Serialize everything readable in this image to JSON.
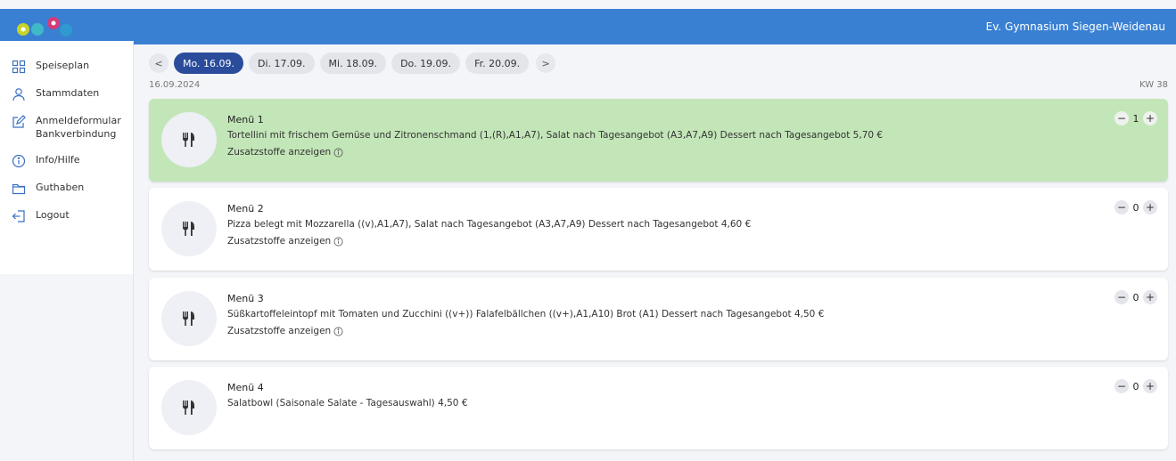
{
  "header": {
    "school_name": "Ev. Gymnasium Siegen-Weidenau"
  },
  "sidebar": {
    "items": [
      {
        "label": "Speiseplan",
        "icon": "grid-icon"
      },
      {
        "label": "Stammdaten",
        "icon": "user-icon"
      },
      {
        "label": "Anmeldeformular Bankverbindung",
        "icon": "edit-icon"
      },
      {
        "label": "Info/Hilfe",
        "icon": "info-icon"
      },
      {
        "label": "Guthaben",
        "icon": "folder-icon"
      },
      {
        "label": "Logout",
        "icon": "logout-icon"
      }
    ]
  },
  "days": {
    "prev": "<",
    "next": ">",
    "items": [
      {
        "label": "Mo. 16.09.",
        "active": true
      },
      {
        "label": "Di. 17.09.",
        "active": false
      },
      {
        "label": "Mi. 18.09.",
        "active": false
      },
      {
        "label": "Do. 19.09.",
        "active": false
      },
      {
        "label": "Fr. 20.09.",
        "active": false
      }
    ]
  },
  "date": "16.09.2024",
  "week": "KW 38",
  "additives_label": "Zusatzstoffe anzeigen",
  "menus": [
    {
      "title": "Menü 1",
      "description": "Tortellini mit frischem Gemüse und Zitronenschmand (1,(R),A1,A7), Salat nach Tagesangebot (A3,A7,A9) Dessert nach Tagesangebot 5,70 €",
      "qty": "1",
      "selected": true,
      "has_additives": true
    },
    {
      "title": "Menü 2",
      "description": "Pizza belegt mit Mozzarella ((v),A1,A7), Salat nach Tagesangebot (A3,A7,A9) Dessert nach Tagesangebot 4,60 €",
      "qty": "0",
      "selected": false,
      "has_additives": true
    },
    {
      "title": "Menü 3",
      "description": "Süßkartoffeleintopf mit Tomaten und Zucchini ((v+)) Falafelbällchen ((v+),A1,A10) Brot (A1) Dessert nach Tagesangebot 4,50 €",
      "qty": "0",
      "selected": false,
      "has_additives": true
    },
    {
      "title": "Menü 4",
      "description": "Salatbowl (Saisonale Salate - Tagesauswahl) 4,50 €",
      "qty": "0",
      "selected": false,
      "has_additives": false
    }
  ],
  "stepper": {
    "minus": "−",
    "plus": "+"
  },
  "colors": {
    "header": "#3a80d2",
    "active_day": "#2a4c9b",
    "selected_card": "#c3e6b8"
  }
}
